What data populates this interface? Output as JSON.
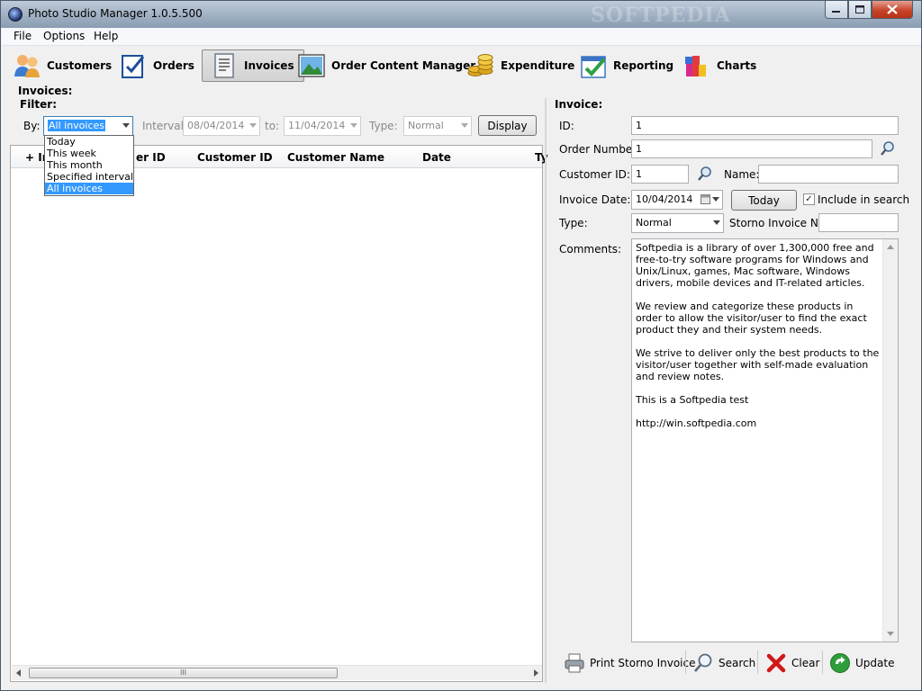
{
  "window": {
    "title": "Photo Studio Manager 1.0.5.500",
    "watermark": "SOFTPEDIA",
    "minimize": "0",
    "maximize": "1",
    "close": "r"
  },
  "menu": [
    "File",
    "Options",
    "Help"
  ],
  "toolbar": {
    "customers": "Customers",
    "orders": "Orders",
    "invoices": "Invoices",
    "order_content_manager": "Order Content Manager",
    "expenditure": "Expenditure",
    "reporting": "Reporting",
    "charts": "Charts"
  },
  "invoices_list": {
    "heading": "Invoices:",
    "filter_heading": "Filter:",
    "by_label": "By:",
    "by_value": "All invoices",
    "interval_label": "Interval:",
    "interval_from": "08/04/2014",
    "to_label": "to:",
    "interval_to": "11/04/2014",
    "type_label": "Type:",
    "type_value": "Normal",
    "display_button": "Display",
    "dropdown_options": [
      "Today",
      "This week",
      "This month",
      "Specified interval",
      "All invoices"
    ],
    "dropdown_selected": "All invoices",
    "columns": [
      "+ In",
      "er ID",
      "Customer ID",
      "Customer Name",
      "Date",
      "Ty"
    ],
    "scroll_grip": "III"
  },
  "invoice_form": {
    "heading": "Invoice:",
    "id_label": "ID:",
    "id_value": "1",
    "order_number_label": "Order Number:",
    "order_number_value": "1",
    "customer_id_label": "Customer ID:",
    "customer_id_value": "1",
    "name_label": "Name:",
    "name_value": "",
    "invoice_date_label": "Invoice Date:",
    "invoice_date_value": "10/04/2014",
    "today_button": "Today",
    "include_in_search_label": "Include in search",
    "include_in_search_checked": true,
    "check_mark": "✓",
    "type_label": "Type:",
    "type_value": "Normal",
    "storno_label": "Storno Invoice No.:",
    "storno_value": "",
    "comments_label": "Comments:",
    "comments": [
      "Softpedia is a library of over 1,300,000 free and free-to-try software programs for Windows and Unix/Linux, games, Mac software, Windows drivers, mobile devices and IT-related articles.",
      "We review and categorize these products in order to allow the visitor/user to find the exact product they and their system needs.",
      "We strive to deliver only the best products to the visitor/user together with self-made evaluation and review notes.",
      "This is a Softpedia test",
      "http://win.softpedia.com"
    ]
  },
  "actions": {
    "print_storno": "Print Storno Invoice",
    "search": "Search",
    "clear": "Clear",
    "update": "Update"
  },
  "colors": {
    "selection": "#3399ff",
    "close_button": "#c8452b",
    "window_frame": "#9fb0c3"
  }
}
